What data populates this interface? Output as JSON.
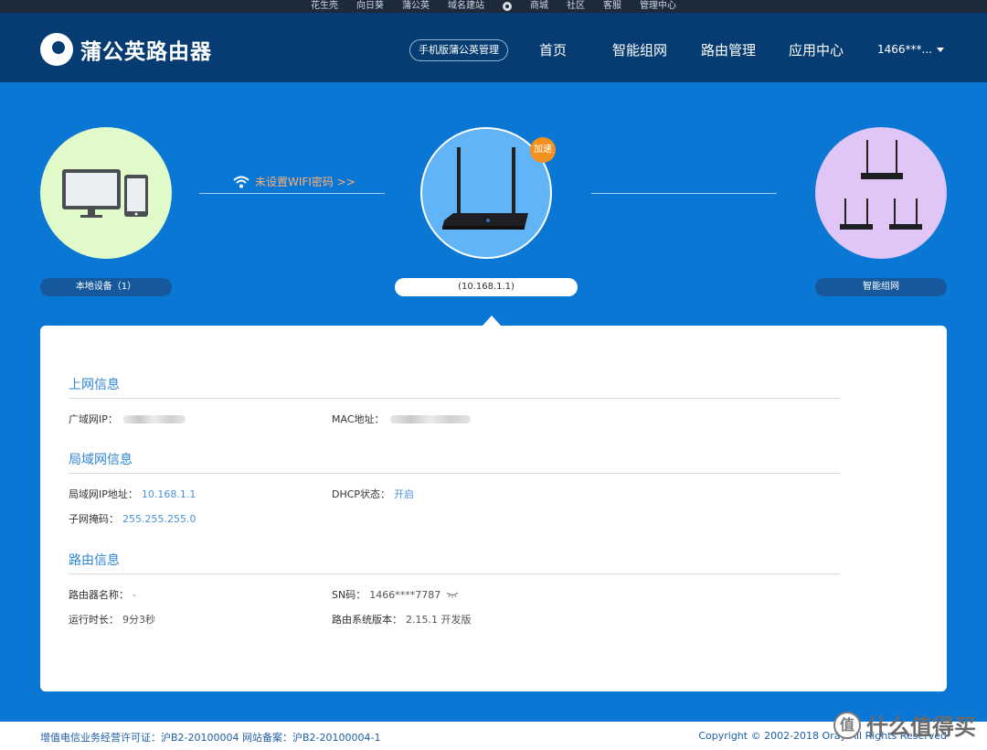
{
  "topbar": {
    "links": [
      "花生壳",
      "向日葵",
      "蒲公英",
      "域名建站",
      "商城",
      "社区",
      "客服",
      "管理中心"
    ]
  },
  "header": {
    "brand": "蒲公英路由器",
    "mobile_manage": "手机版蒲公英管理",
    "nav": [
      "首页",
      "智能组网",
      "路由管理",
      "应用中心"
    ],
    "user": "1466***..."
  },
  "diagram": {
    "wifi_hint": "未设置WIFI密码 >>",
    "boost_badge": "加速",
    "local_devices": "本地设备（1）",
    "router_ip": "(10.168.1.1)",
    "mesh": "智能组网"
  },
  "info": {
    "internet": {
      "title": "上网信息",
      "wan_ip_label": "广域网IP：",
      "mac_label": "MAC地址："
    },
    "lan": {
      "title": "局域网信息",
      "lan_ip_label": "局域网IP地址：",
      "lan_ip_value": "10.168.1.1",
      "dhcp_label": "DHCP状态：",
      "dhcp_value": "开启",
      "subnet_label": "子网掩码：",
      "subnet_value": "255.255.255.0"
    },
    "router": {
      "title": "路由信息",
      "name_label": "路由器名称：",
      "name_value": "-",
      "sn_label": "SN码：",
      "sn_value": "1466****7787",
      "uptime_label": "运行时长：",
      "uptime_value": "9分3秒",
      "version_label": "路由系统版本：",
      "version_value": "2.15.1 开发版"
    }
  },
  "footer": {
    "license": "增值电信业务经营许可证：沪B2-20100004 网站备案：沪B2-20100004-1",
    "copyright": "Copyright © 2002-2018 Oray All Rights Reserved"
  },
  "watermark": {
    "badge": "值",
    "text": "什么值得买"
  },
  "colors": {
    "background": "#0b77d4",
    "header": "#063c72",
    "accent_orange": "#f4911d",
    "link_blue": "#4a92d6"
  }
}
